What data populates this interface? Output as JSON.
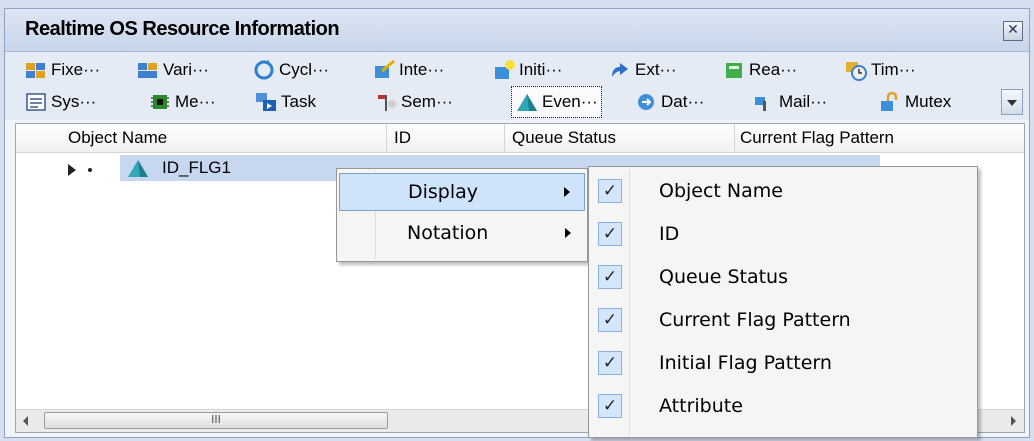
{
  "window": {
    "title": "Realtime OS Resource Information",
    "close_glyph": "✕"
  },
  "toolbar": {
    "row1": [
      {
        "label": "Fixe···",
        "icon": "fixed-memory-pool-icon"
      },
      {
        "label": "Vari···",
        "icon": "variable-memory-pool-icon"
      },
      {
        "label": "Cycl···",
        "icon": "cyclic-handler-icon"
      },
      {
        "label": "Inte···",
        "icon": "interrupt-handler-icon"
      },
      {
        "label": "Initi···",
        "icon": "initialization-routine-icon"
      },
      {
        "label": "Ext···",
        "icon": "extended-service-call-icon"
      },
      {
        "label": "Rea···",
        "icon": "ready-queue-icon"
      },
      {
        "label": "Tim···",
        "icon": "timer-queue-icon"
      }
    ],
    "row2": [
      {
        "label": "Sys···",
        "icon": "system-information-icon"
      },
      {
        "label": "Me···",
        "icon": "memory-icon"
      },
      {
        "label": "Task",
        "icon": "task-icon"
      },
      {
        "label": "Sem···",
        "icon": "semaphore-icon"
      },
      {
        "label": "Even···",
        "icon": "eventflag-icon",
        "active": true
      },
      {
        "label": "Dat···",
        "icon": "data-queue-icon"
      },
      {
        "label": "Mail···",
        "icon": "mailbox-icon"
      },
      {
        "label": "Mutex",
        "icon": "mutex-icon"
      }
    ]
  },
  "table": {
    "columns": [
      "Object Name",
      "ID",
      "Queue Status",
      "Current Flag Pattern"
    ],
    "rows": [
      {
        "object_name": "ID_FLG1"
      }
    ]
  },
  "scrollbar": {
    "thumb_glyph": "III"
  },
  "context_menu": {
    "items": [
      {
        "label": "Display",
        "highlighted": true
      },
      {
        "label": "Notation",
        "highlighted": false
      }
    ]
  },
  "display_submenu": {
    "check_glyph": "✓",
    "items": [
      {
        "label": "Object Name",
        "checked": true
      },
      {
        "label": "ID",
        "checked": true
      },
      {
        "label": "Queue Status",
        "checked": true
      },
      {
        "label": "Current Flag Pattern",
        "checked": true
      },
      {
        "label": "Initial Flag Pattern",
        "checked": true
      },
      {
        "label": "Attribute",
        "checked": true
      }
    ]
  },
  "colors": {
    "selection": "#c7d7f0",
    "menu_highlight": "#cfe3fb",
    "check_bg": "#d4e6fb"
  }
}
